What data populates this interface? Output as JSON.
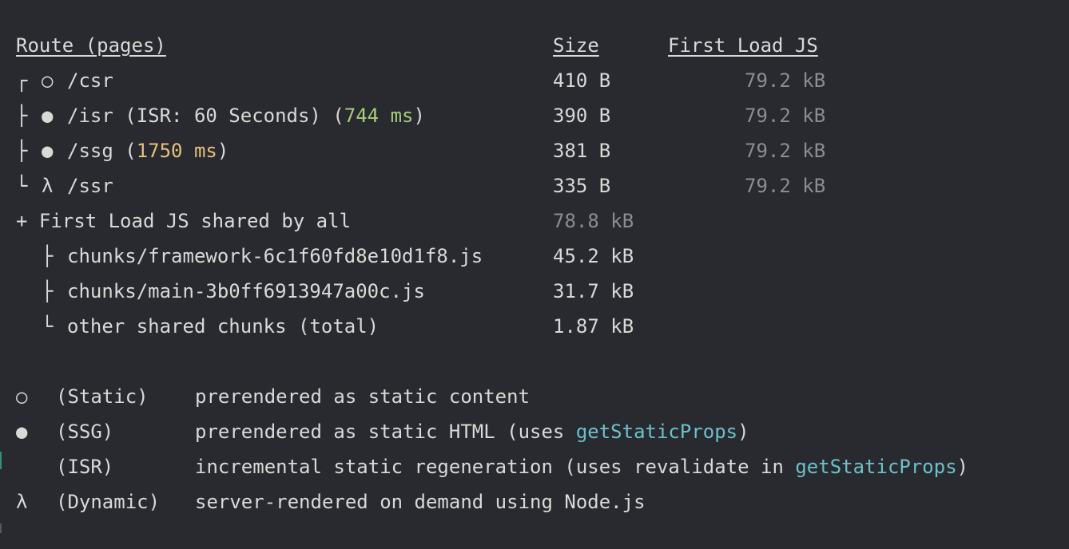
{
  "header": {
    "route": "Route (pages)",
    "size": "Size",
    "first_load": "First Load JS"
  },
  "routes": [
    {
      "tree": "┌",
      "sym": "○",
      "path": "/csr",
      "note_pre": "",
      "note_time": "",
      "note_post": "",
      "time_color": "",
      "size": "410 B",
      "first_load": "79.2 kB"
    },
    {
      "tree": "├",
      "sym": "●",
      "path": "/isr",
      "note_pre": " (ISR: 60 Seconds) (",
      "note_time": "744 ms",
      "note_post": ")",
      "time_color": "green",
      "size": "390 B",
      "first_load": "79.2 kB"
    },
    {
      "tree": "├",
      "sym": "●",
      "path": "/ssg",
      "note_pre": " (",
      "note_time": "1750 ms",
      "note_post": ")",
      "time_color": "yellow",
      "size": "381 B",
      "first_load": "79.2 kB"
    },
    {
      "tree": "└",
      "sym": "λ",
      "path": "/ssr",
      "note_pre": "",
      "note_time": "",
      "note_post": "",
      "time_color": "",
      "size": "335 B",
      "first_load": "79.2 kB"
    }
  ],
  "shared": {
    "label": "+ First Load JS shared by all",
    "size": "78.8 kB",
    "chunks": [
      {
        "tree": "├",
        "name": "chunks/framework-6c1f60fd8e10d1f8.js",
        "size": "45.2 kB"
      },
      {
        "tree": "├",
        "name": "chunks/main-3b0ff6913947a00c.js",
        "size": "31.7 kB"
      },
      {
        "tree": "└",
        "name": "other shared chunks (total)",
        "size": "1.87 kB"
      }
    ]
  },
  "legend": [
    {
      "sym": "○",
      "type": "(Static)",
      "desc_pre": "prerendered as static content",
      "desc_link": "",
      "desc_post": ""
    },
    {
      "sym": "●",
      "type": "(SSG)",
      "desc_pre": "prerendered as static HTML (uses ",
      "desc_link": "getStaticProps",
      "desc_post": ")"
    },
    {
      "sym": "",
      "type": "(ISR)",
      "desc_pre": "incremental static regeneration (uses revalidate in ",
      "desc_link": "getStaticProps",
      "desc_post": ")"
    },
    {
      "sym": "λ",
      "type": "(Dynamic)",
      "desc_pre": "server-rendered on demand using Node.js",
      "desc_link": "",
      "desc_post": ""
    }
  ],
  "colors": {
    "background": "#282a2f",
    "text": "#d9d9d9",
    "dim": "#8a8d93",
    "green": "#a8cc7c",
    "yellow": "#e6c07b",
    "cyan": "#6cc1c8"
  }
}
